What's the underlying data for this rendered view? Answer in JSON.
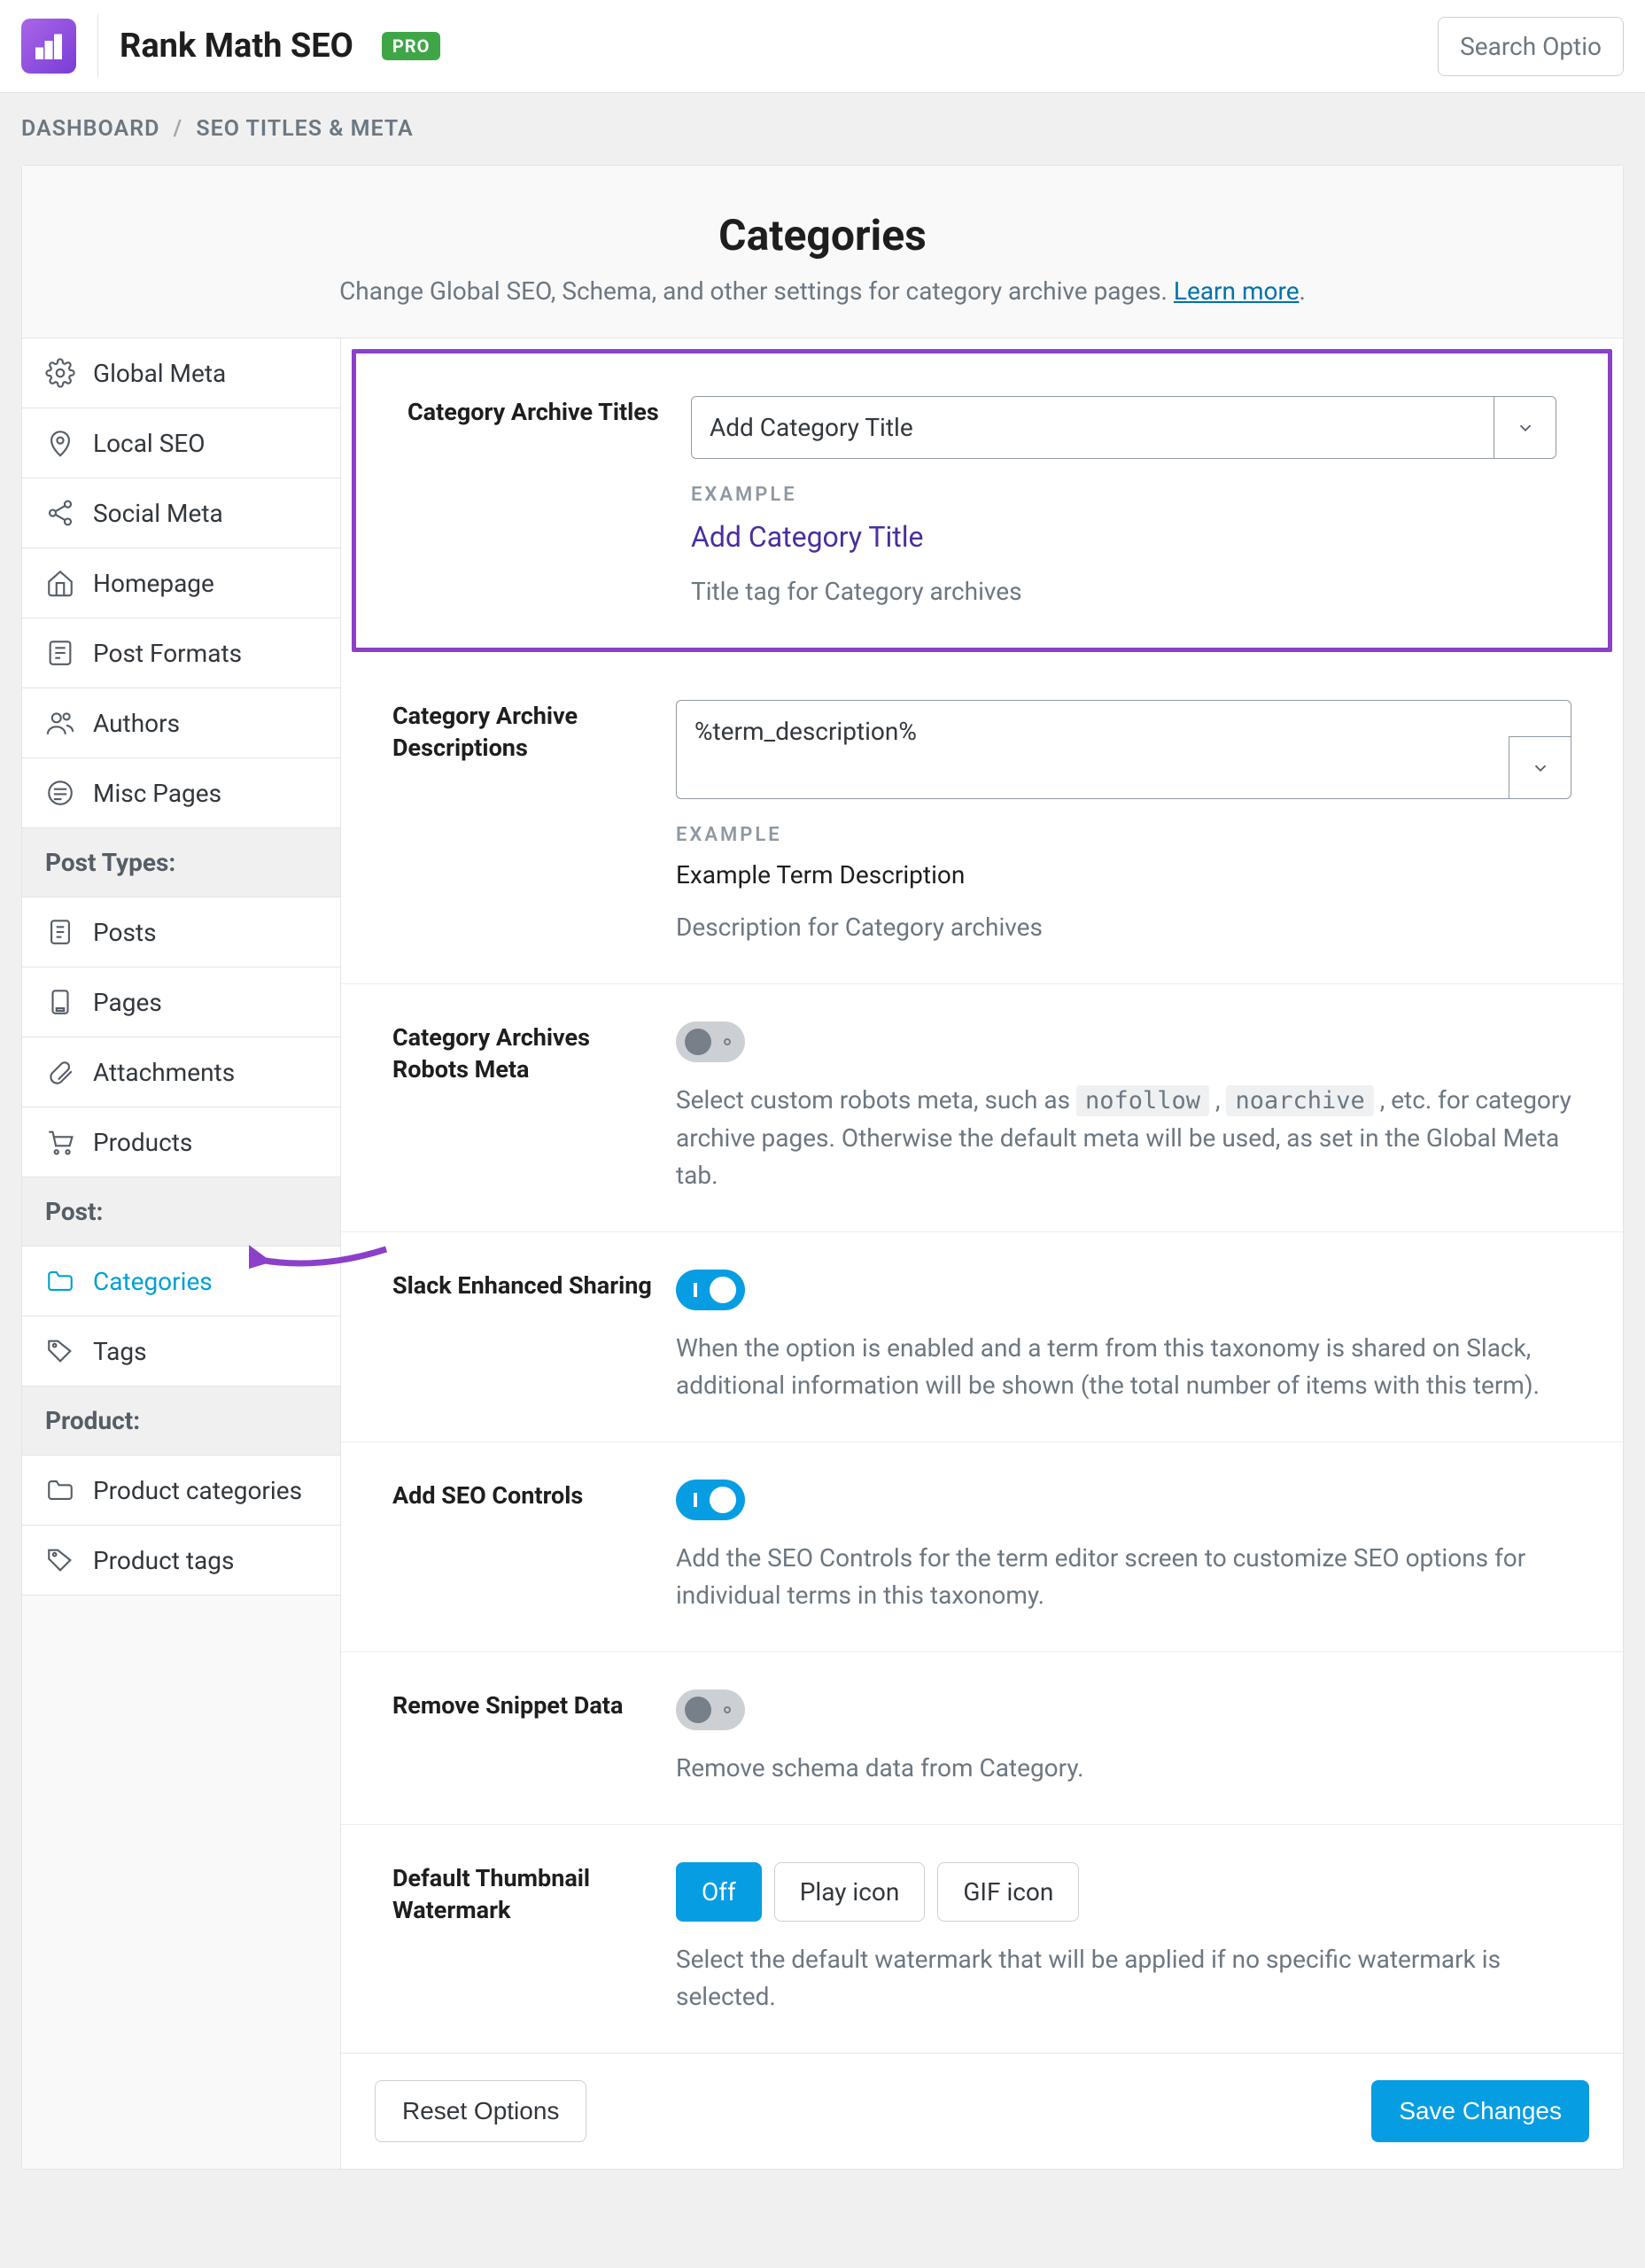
{
  "topbar": {
    "title": "Rank Math SEO",
    "badge": "PRO",
    "search_placeholder": "Search Optio"
  },
  "breadcrumb": {
    "root": "DASHBOARD",
    "current": "SEO TITLES & META"
  },
  "page": {
    "title": "Categories",
    "subtitle": "Change Global SEO, Schema, and other settings for category archive pages. ",
    "learn_more": "Learn more"
  },
  "sidebar": {
    "items": [
      {
        "label": "Global Meta",
        "icon": "gear"
      },
      {
        "label": "Local SEO",
        "icon": "pin"
      },
      {
        "label": "Social Meta",
        "icon": "share"
      },
      {
        "label": "Homepage",
        "icon": "home"
      },
      {
        "label": "Post Formats",
        "icon": "list"
      },
      {
        "label": "Authors",
        "icon": "users"
      },
      {
        "label": "Misc Pages",
        "icon": "lines"
      }
    ],
    "group_post_types": "Post Types:",
    "post_types": [
      {
        "label": "Posts",
        "icon": "document"
      },
      {
        "label": "Pages",
        "icon": "page"
      },
      {
        "label": "Attachments",
        "icon": "paperclip"
      },
      {
        "label": "Products",
        "icon": "cart"
      }
    ],
    "group_post": "Post:",
    "post_tax": [
      {
        "label": "Categories",
        "icon": "folder",
        "active": true
      },
      {
        "label": "Tags",
        "icon": "tag"
      }
    ],
    "group_product": "Product:",
    "product_tax": [
      {
        "label": "Product categories",
        "icon": "folder"
      },
      {
        "label": "Product tags",
        "icon": "tag"
      }
    ]
  },
  "fields": {
    "archive_titles": {
      "label": "Category Archive Titles",
      "value": "Add Category Title",
      "example_label": "EXAMPLE",
      "example_value": "Add Category Title",
      "help": "Title tag for Category archives"
    },
    "archive_descriptions": {
      "label": "Category Archive Descriptions",
      "value": "%term_description%",
      "example_label": "EXAMPLE",
      "example_value": "Example Term Description",
      "help": "Description for Category archives"
    },
    "robots_meta": {
      "label": "Category Archives Robots Meta",
      "help_pre": "Select custom robots meta, such as ",
      "code1": "nofollow",
      "code2": "noarchive",
      "help_post": ", etc. for category archive pages. Otherwise the default meta will be used, as set in the Global Meta tab."
    },
    "slack": {
      "label": "Slack Enhanced Sharing",
      "help": "When the option is enabled and a term from this taxonomy is shared on Slack, additional information will be shown (the total number of items with this term)."
    },
    "seo_controls": {
      "label": "Add SEO Controls",
      "help": "Add the SEO Controls for the term editor screen to customize SEO options for individual terms in this taxonomy."
    },
    "remove_snippet": {
      "label": "Remove Snippet Data",
      "help": "Remove schema data from Category."
    },
    "thumbnail": {
      "label": "Default Thumbnail Watermark",
      "options": [
        "Off",
        "Play icon",
        "GIF icon"
      ],
      "help": "Select the default watermark that will be applied if no specific watermark is selected."
    }
  },
  "footer": {
    "reset": "Reset Options",
    "save": "Save Changes"
  }
}
